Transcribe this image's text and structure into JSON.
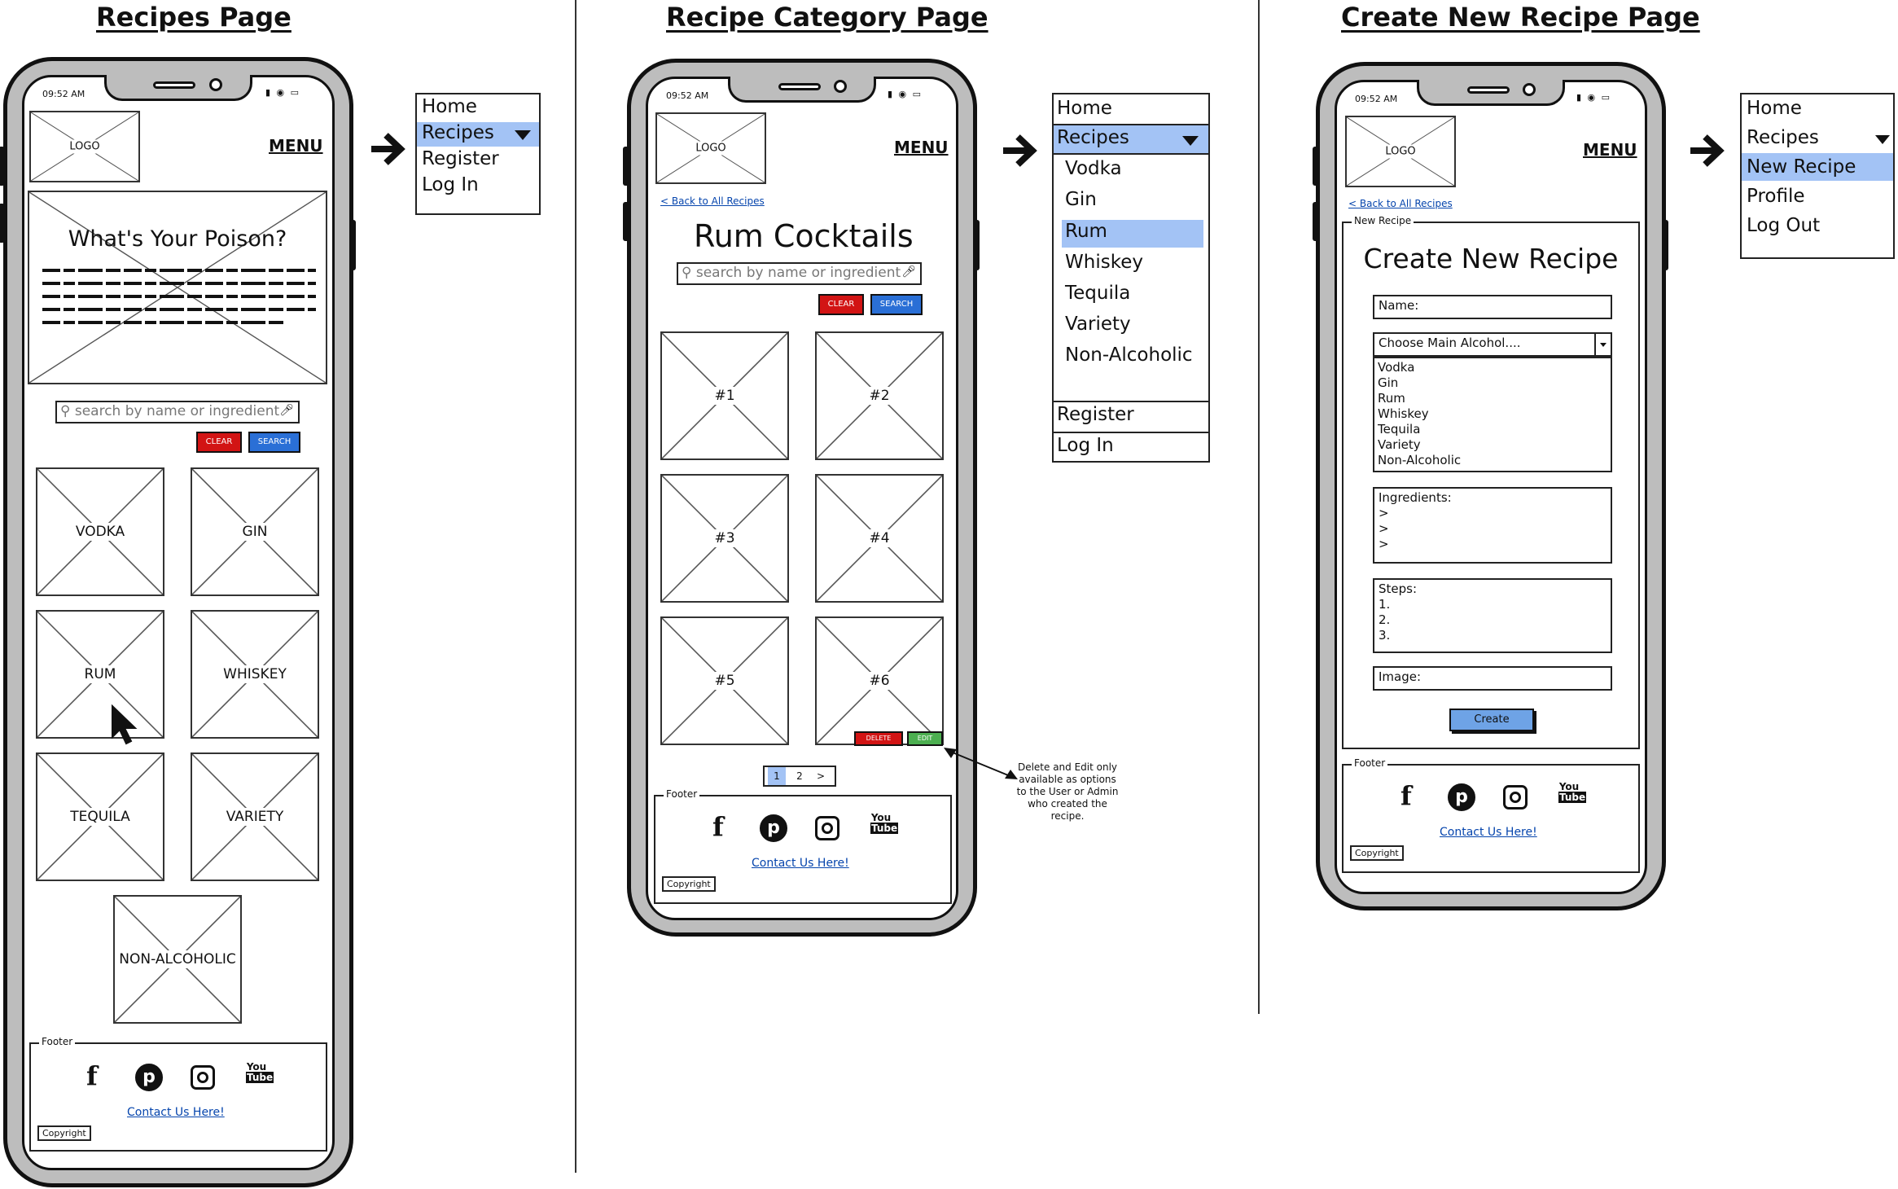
{
  "titles": {
    "recipes": "Recipes Page",
    "category": "Recipe Category Page",
    "create": "Create New Recipe Page"
  },
  "status": {
    "time": "09:52 AM",
    "icons": "▮ ◉ ▭"
  },
  "header": {
    "logo": "LOGO",
    "menu": "MENU"
  },
  "search": {
    "placeholder": "search by name or ingredient",
    "clear": "CLEAR",
    "search": "SEARCH"
  },
  "recipes_page": {
    "hero_title": "What's Your Poison?",
    "categories": [
      "VODKA",
      "GIN",
      "RUM",
      "WHISKEY",
      "TEQUILA",
      "VARIETY",
      "NON-ALCOHOLIC"
    ],
    "menu": [
      "Home",
      "Recipes",
      "Register",
      "Log In"
    ]
  },
  "category_page": {
    "back": "< Back to All Recipes",
    "title": "Rum Cocktails",
    "items": [
      "#1",
      "#2",
      "#3",
      "#4",
      "#5",
      "#6"
    ],
    "delete": "DELETE",
    "edit": "EDIT",
    "pages": [
      "1",
      "2",
      ">"
    ],
    "note": "Delete and Edit only available as options to the User or Admin who created the recipe.",
    "menu": [
      "Home",
      "Recipes",
      "Vodka",
      "Gin",
      "Rum",
      "Whiskey",
      "Tequila",
      "Variety",
      "Non-Alcoholic",
      "Register",
      "Log In"
    ]
  },
  "create_page": {
    "back": "< Back to All Recipes",
    "legend": "New Recipe",
    "title": "Create New Recipe",
    "name_label": "Name:",
    "select_label": "Choose Main Alcohol....",
    "options": [
      "Vodka",
      "Gin",
      "Rum",
      "Whiskey",
      "Tequila",
      "Variety",
      "Non-Alcoholic"
    ],
    "ingredients_label": "Ingredients:",
    "ingredient_bullets": [
      ">",
      ">",
      ">"
    ],
    "steps_label": "Steps:",
    "steps": [
      "1.",
      "2.",
      "3."
    ],
    "image_label": "Image:",
    "create": "Create",
    "menu": [
      "Home",
      "Recipes",
      "New Recipe",
      "Profile",
      "Log Out"
    ]
  },
  "footer": {
    "legend": "Footer",
    "contact": "Contact Us Here!",
    "copyright": "Copyright",
    "youtube_top": "You",
    "youtube_bottom": "Tube"
  },
  "icons": [
    "facebook-icon",
    "pinterest-icon",
    "instagram-icon",
    "youtube-icon",
    "arrow-right-icon",
    "caret-down-icon",
    "cursor-icon",
    "microphone-icon",
    "search-icon"
  ],
  "colors": {
    "highlight": "#a3c3f5",
    "clear": "#d21414",
    "search": "#2a6fd6",
    "edit": "#4caf50",
    "link": "#0645ad"
  }
}
